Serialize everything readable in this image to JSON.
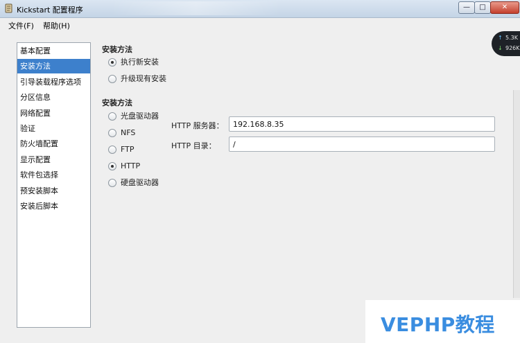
{
  "window": {
    "title": "Kickstart 配置程序",
    "controls": {
      "minimize": "—",
      "maximize": "□",
      "close": "✕"
    }
  },
  "menu": [
    {
      "label": "文件(F)"
    },
    {
      "label": "帮助(H)"
    }
  ],
  "sidebar": {
    "selected_index": 1,
    "items": [
      {
        "label": "基本配置"
      },
      {
        "label": "安装方法"
      },
      {
        "label": "引导装载程序选项"
      },
      {
        "label": "分区信息"
      },
      {
        "label": "网络配置"
      },
      {
        "label": "验证"
      },
      {
        "label": "防火墙配置"
      },
      {
        "label": "显示配置"
      },
      {
        "label": "软件包选择"
      },
      {
        "label": "预安装脚本"
      },
      {
        "label": "安装后脚本"
      }
    ]
  },
  "install_type": {
    "title": "安装方法",
    "options": [
      {
        "label": "执行新安装",
        "checked": true
      },
      {
        "label": "升级现有安装",
        "checked": false
      }
    ]
  },
  "install_method": {
    "title": "安装方法",
    "options": [
      {
        "label": "光盘驱动器",
        "checked": false
      },
      {
        "label": "NFS",
        "checked": false
      },
      {
        "label": "FTP",
        "checked": false
      },
      {
        "label": "HTTP",
        "checked": true
      },
      {
        "label": "硬盘驱动器",
        "checked": false
      }
    ]
  },
  "http": {
    "server_label": "HTTP 服务器：",
    "server_value": "192.168.8.35",
    "dir_label": "HTTP 目录：",
    "dir_value": "/"
  },
  "net_widget": {
    "up_arrow": "↑",
    "up_value": "5.3K",
    "down_arrow": "↓",
    "down_value": "926K"
  },
  "watermark": {
    "text": "VEPHP教程",
    "color": "#3a8de0"
  },
  "colors": {
    "selection": "#3d80cc",
    "titlebar": "#c4d4e6"
  }
}
